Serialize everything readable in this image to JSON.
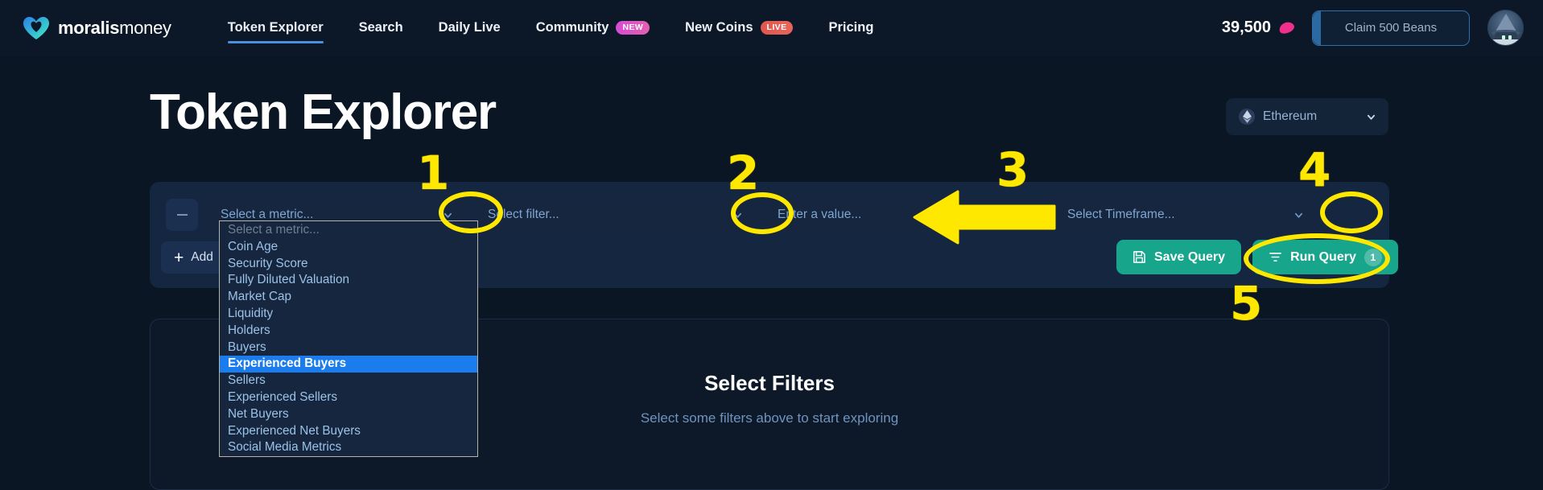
{
  "nav": {
    "logo": {
      "bold": "moralis",
      "light": "money",
      "icon": "moralis-heart-logo"
    },
    "items": [
      {
        "label": "Token Explorer",
        "active": true,
        "badge": null
      },
      {
        "label": "Search",
        "active": false,
        "badge": null
      },
      {
        "label": "Daily Live",
        "active": false,
        "badge": null
      },
      {
        "label": "Community",
        "active": false,
        "badge": "NEW",
        "badge_color": "#d64bd6"
      },
      {
        "label": "New Coins",
        "active": false,
        "badge": "LIVE",
        "badge_color": "#e0574f"
      },
      {
        "label": "Pricing",
        "active": false,
        "badge": null
      }
    ],
    "beans_count": "39,500",
    "beans_icon": "bean-icon",
    "claim_label": "Claim 500 Beans",
    "avatar_icon": "wizard-avatar"
  },
  "header": {
    "title": "Token Explorer",
    "chain": {
      "label": "Ethereum",
      "icon": "ethereum-icon"
    }
  },
  "filters": {
    "remove_icon": "minus-icon",
    "metric_placeholder": "Select a metric...",
    "filter_placeholder": "Select filter...",
    "value_placeholder": "Enter a value...",
    "timeframe_placeholder": "Select Timeframe...",
    "add_label": "Add",
    "add_icon": "plus-icon",
    "save_label": "Save Query",
    "save_icon": "floppy-disk-icon",
    "run_label": "Run Query",
    "run_icon": "filter-funnel-icon",
    "run_count": "1"
  },
  "metric_dropdown": {
    "options": [
      "Select a metric...",
      "Coin Age",
      "Security Score",
      "Fully Diluted Valuation",
      "Market Cap",
      "Liquidity",
      "Holders",
      "Buyers",
      "Experienced Buyers",
      "Sellers",
      "Experienced Sellers",
      "Net Buyers",
      "Experienced Net Buyers",
      "Social Media Metrics"
    ],
    "selected": "Experienced Buyers",
    "placeholder_index": 0,
    "highlight_color": "#1b7ced"
  },
  "results": {
    "title": "Select Filters",
    "subtitle": "Select some filters above to start exploring"
  },
  "annotations": {
    "color": "#ffe800",
    "markers": [
      {
        "number": "1",
        "target": "metric-dropdown-caret"
      },
      {
        "number": "2",
        "target": "filter-dropdown-caret"
      },
      {
        "number": "3",
        "target": "value-input"
      },
      {
        "number": "4",
        "target": "timeframe-dropdown-caret"
      },
      {
        "number": "5",
        "target": "run-query-button"
      }
    ]
  }
}
